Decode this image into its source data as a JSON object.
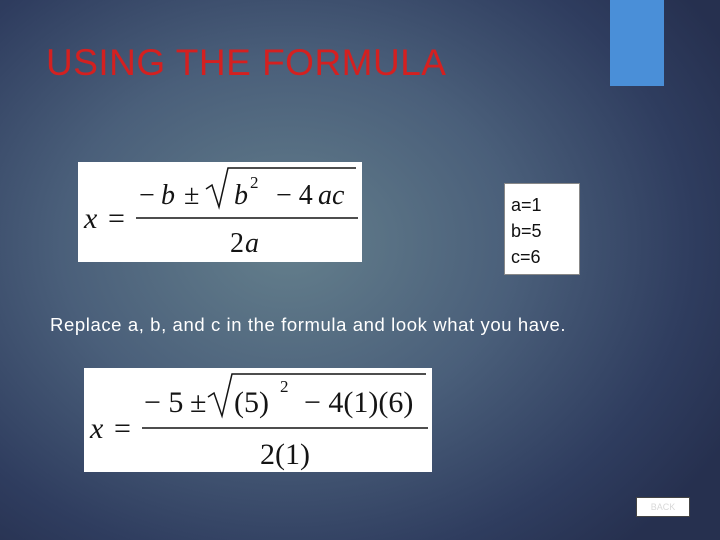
{
  "slide": {
    "title": "USING THE FORMULA",
    "instruction": "Replace a, b, and c in the formula and look what you have.",
    "back_label": "BACK"
  },
  "values": [
    {
      "text": "a=1"
    },
    {
      "text": "b=5"
    },
    {
      "text": "c=6"
    }
  ],
  "formula_general": {
    "lhs": "x",
    "equals": "=",
    "neg_b": "−",
    "b": "b",
    "plus_minus": "±",
    "radicand_b": "b",
    "exponent": "2",
    "minus_4ac": "− 4",
    "ac": "ac",
    "den_two": "2",
    "den_a": "a"
  },
  "formula_substituted": {
    "lhs": "x",
    "equals": "=",
    "neg_five": "− 5",
    "plus_minus": "±",
    "radicand_left": "(5)",
    "exponent": "2",
    "radicand_right": "− 4(1)(6)",
    "denominator": "2(1)"
  },
  "colors": {
    "title": "#d42020",
    "accent_bar": "#4a8fd8",
    "formula_background": "#ffffff"
  }
}
